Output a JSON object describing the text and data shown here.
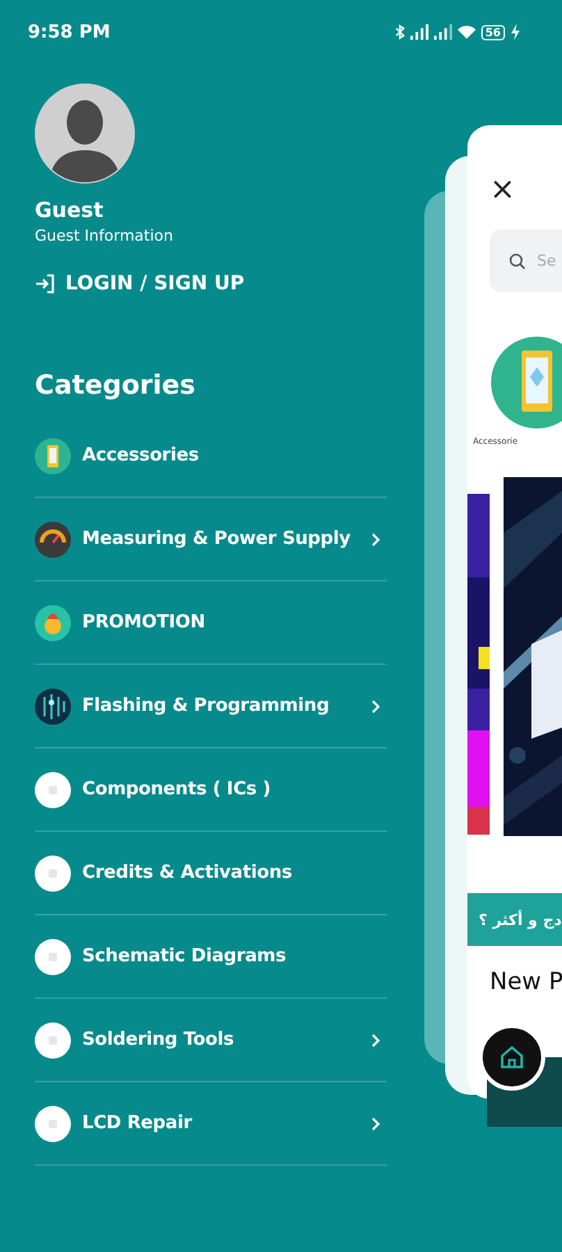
{
  "status_bar": {
    "time": "9:58 PM",
    "battery": "56"
  },
  "profile": {
    "name": "Guest",
    "subtitle": "Guest Information",
    "login": "LOGIN / SIGN UP"
  },
  "categories": {
    "title": "Categories",
    "items": [
      {
        "label": "Accessories",
        "kind": "phone",
        "has_submenu": false
      },
      {
        "label": "Measuring & Power Supply",
        "kind": "gauge",
        "has_submenu": true
      },
      {
        "label": "PROMOTION",
        "kind": "promo",
        "has_submenu": false
      },
      {
        "label": "Flashing & Programming",
        "kind": "circuit",
        "has_submenu": true
      },
      {
        "label": "Components ( ICs )",
        "kind": "blank",
        "has_submenu": false
      },
      {
        "label": "Credits & Activations",
        "kind": "blank",
        "has_submenu": false
      },
      {
        "label": "Schematic Diagrams",
        "kind": "blank",
        "has_submenu": false
      },
      {
        "label": "Soldering Tools",
        "kind": "blank",
        "has_submenu": true
      },
      {
        "label": "LCD Repair",
        "kind": "blank",
        "has_submenu": true
      }
    ]
  },
  "preview": {
    "close": "×",
    "search_placeholder": "Se",
    "category_label": "Accessorie",
    "promo_strip": "دج و أكثر ؟",
    "section_title": "New P"
  }
}
